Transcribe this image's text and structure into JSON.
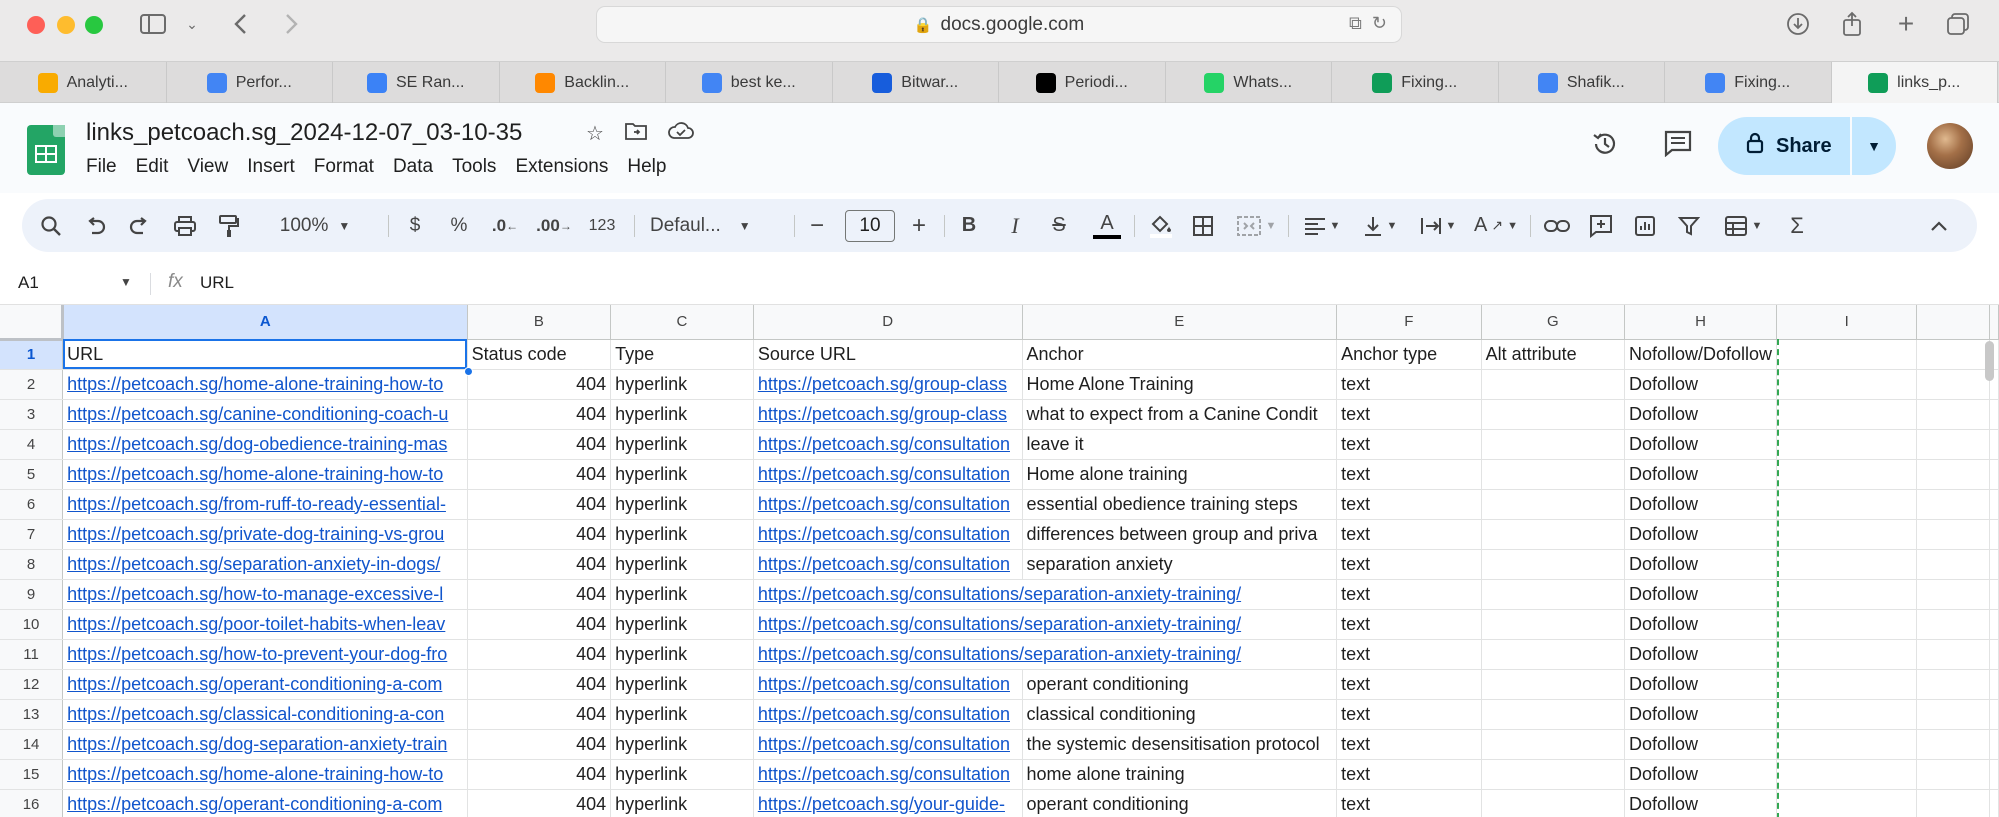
{
  "browser": {
    "url": "docs.google.com",
    "tabs": [
      {
        "label": "Analyti...",
        "icon": "analytics-icon",
        "color": "#f9ab00"
      },
      {
        "label": "Perfor...",
        "icon": "performance-icon",
        "color": "#4285f4"
      },
      {
        "label": "SE Ran...",
        "icon": "se-ranking-icon",
        "color": "#3b82f6"
      },
      {
        "label": "Backlin...",
        "icon": "ahrefs-icon",
        "color": "#ff8800"
      },
      {
        "label": "best ke...",
        "icon": "google-icon",
        "color": "#4285f4"
      },
      {
        "label": "Bitwar...",
        "icon": "bitwarden-icon",
        "color": "#175ddc"
      },
      {
        "label": "Periodi...",
        "icon": "notion-icon",
        "color": "#000000"
      },
      {
        "label": "Whats...",
        "icon": "whatsapp-icon",
        "color": "#25d366"
      },
      {
        "label": "Fixing...",
        "icon": "google-drive-icon",
        "color": "#0f9d58"
      },
      {
        "label": "Shafik...",
        "icon": "google-docs-icon",
        "color": "#4285f4"
      },
      {
        "label": "Fixing...",
        "icon": "google-docs-icon",
        "color": "#4285f4"
      },
      {
        "label": "links_p...",
        "icon": "google-sheets-icon",
        "color": "#0f9d58"
      }
    ]
  },
  "doc": {
    "title": "links_petcoach.sg_2024-12-07_03-10-35",
    "menu": [
      "File",
      "Edit",
      "View",
      "Insert",
      "Format",
      "Data",
      "Tools",
      "Extensions",
      "Help"
    ],
    "share_label": "Share"
  },
  "toolbar": {
    "zoom": "100%",
    "currency": "$",
    "percent": "%",
    "dec_less": ".0",
    "dec_more": ".00",
    "number_format": "123",
    "font": "Defaul...",
    "font_size": "10"
  },
  "formula_bar": {
    "cell_ref": "A1",
    "fx": "fx",
    "value": "URL"
  },
  "sheet": {
    "columns": [
      "A",
      "B",
      "C",
      "D",
      "E",
      "F",
      "G",
      "H",
      "I"
    ],
    "rows": [
      {
        "n": "1",
        "cells": [
          "URL",
          "Status code",
          "Type",
          "Source URL",
          "Anchor",
          "Anchor type",
          "Alt attribute",
          "Nofollow/Dofollow",
          ""
        ]
      },
      {
        "n": "2",
        "cells": [
          "https://petcoach.sg/home-alone-training-how-to",
          "404",
          "hyperlink",
          "https://petcoach.sg/group-class",
          "Home Alone Training",
          "text",
          "",
          "Dofollow",
          ""
        ]
      },
      {
        "n": "3",
        "cells": [
          "https://petcoach.sg/canine-conditioning-coach-u",
          "404",
          "hyperlink",
          "https://petcoach.sg/group-class",
          "what to expect from a Canine Condit",
          "text",
          "",
          "Dofollow",
          ""
        ]
      },
      {
        "n": "4",
        "cells": [
          "https://petcoach.sg/dog-obedience-training-mas",
          "404",
          "hyperlink",
          "https://petcoach.sg/consultation",
          "leave it",
          "text",
          "",
          "Dofollow",
          ""
        ]
      },
      {
        "n": "5",
        "cells": [
          "https://petcoach.sg/home-alone-training-how-to",
          "404",
          "hyperlink",
          "https://petcoach.sg/consultation",
          "Home alone training",
          "text",
          "",
          "Dofollow",
          ""
        ]
      },
      {
        "n": "6",
        "cells": [
          "https://petcoach.sg/from-ruff-to-ready-essential-",
          "404",
          "hyperlink",
          "https://petcoach.sg/consultation",
          "essential obedience training steps",
          "text",
          "",
          "Dofollow",
          ""
        ]
      },
      {
        "n": "7",
        "cells": [
          "https://petcoach.sg/private-dog-training-vs-grou",
          "404",
          "hyperlink",
          "https://petcoach.sg/consultation",
          "differences between group and priva",
          "text",
          "",
          "Dofollow",
          ""
        ]
      },
      {
        "n": "8",
        "cells": [
          "https://petcoach.sg/separation-anxiety-in-dogs/",
          "404",
          "hyperlink",
          "https://petcoach.sg/consultation",
          "separation anxiety",
          "text",
          "",
          "Dofollow",
          ""
        ]
      },
      {
        "n": "9",
        "cells": [
          "https://petcoach.sg/how-to-manage-excessive-l",
          "404",
          "hyperlink",
          "https://petcoach.sg/consultations/separation-anxiety-training/",
          "",
          "text",
          "",
          "Dofollow",
          ""
        ]
      },
      {
        "n": "10",
        "cells": [
          "https://petcoach.sg/poor-toilet-habits-when-leav",
          "404",
          "hyperlink",
          "https://petcoach.sg/consultations/separation-anxiety-training/",
          "",
          "text",
          "",
          "Dofollow",
          ""
        ]
      },
      {
        "n": "11",
        "cells": [
          "https://petcoach.sg/how-to-prevent-your-dog-fro",
          "404",
          "hyperlink",
          "https://petcoach.sg/consultations/separation-anxiety-training/",
          "",
          "text",
          "",
          "Dofollow",
          ""
        ]
      },
      {
        "n": "12",
        "cells": [
          "https://petcoach.sg/operant-conditioning-a-com",
          "404",
          "hyperlink",
          "https://petcoach.sg/consultation",
          "operant conditioning",
          "text",
          "",
          "Dofollow",
          ""
        ]
      },
      {
        "n": "13",
        "cells": [
          "https://petcoach.sg/classical-conditioning-a-con",
          "404",
          "hyperlink",
          "https://petcoach.sg/consultation",
          "classical conditioning",
          "text",
          "",
          "Dofollow",
          ""
        ]
      },
      {
        "n": "14",
        "cells": [
          "https://petcoach.sg/dog-separation-anxiety-train",
          "404",
          "hyperlink",
          "https://petcoach.sg/consultation",
          "the systemic desensitisation protocol",
          "text",
          "",
          "Dofollow",
          ""
        ]
      },
      {
        "n": "15",
        "cells": [
          "https://petcoach.sg/home-alone-training-how-to",
          "404",
          "hyperlink",
          "https://petcoach.sg/consultation",
          "home alone training",
          "text",
          "",
          "Dofollow",
          ""
        ]
      },
      {
        "n": "16",
        "cells": [
          "https://petcoach.sg/operant-conditioning-a-com",
          "404",
          "hyperlink",
          "https://petcoach.sg/your-guide-",
          "operant conditioning",
          "text",
          "",
          "Dofollow",
          ""
        ]
      }
    ]
  }
}
